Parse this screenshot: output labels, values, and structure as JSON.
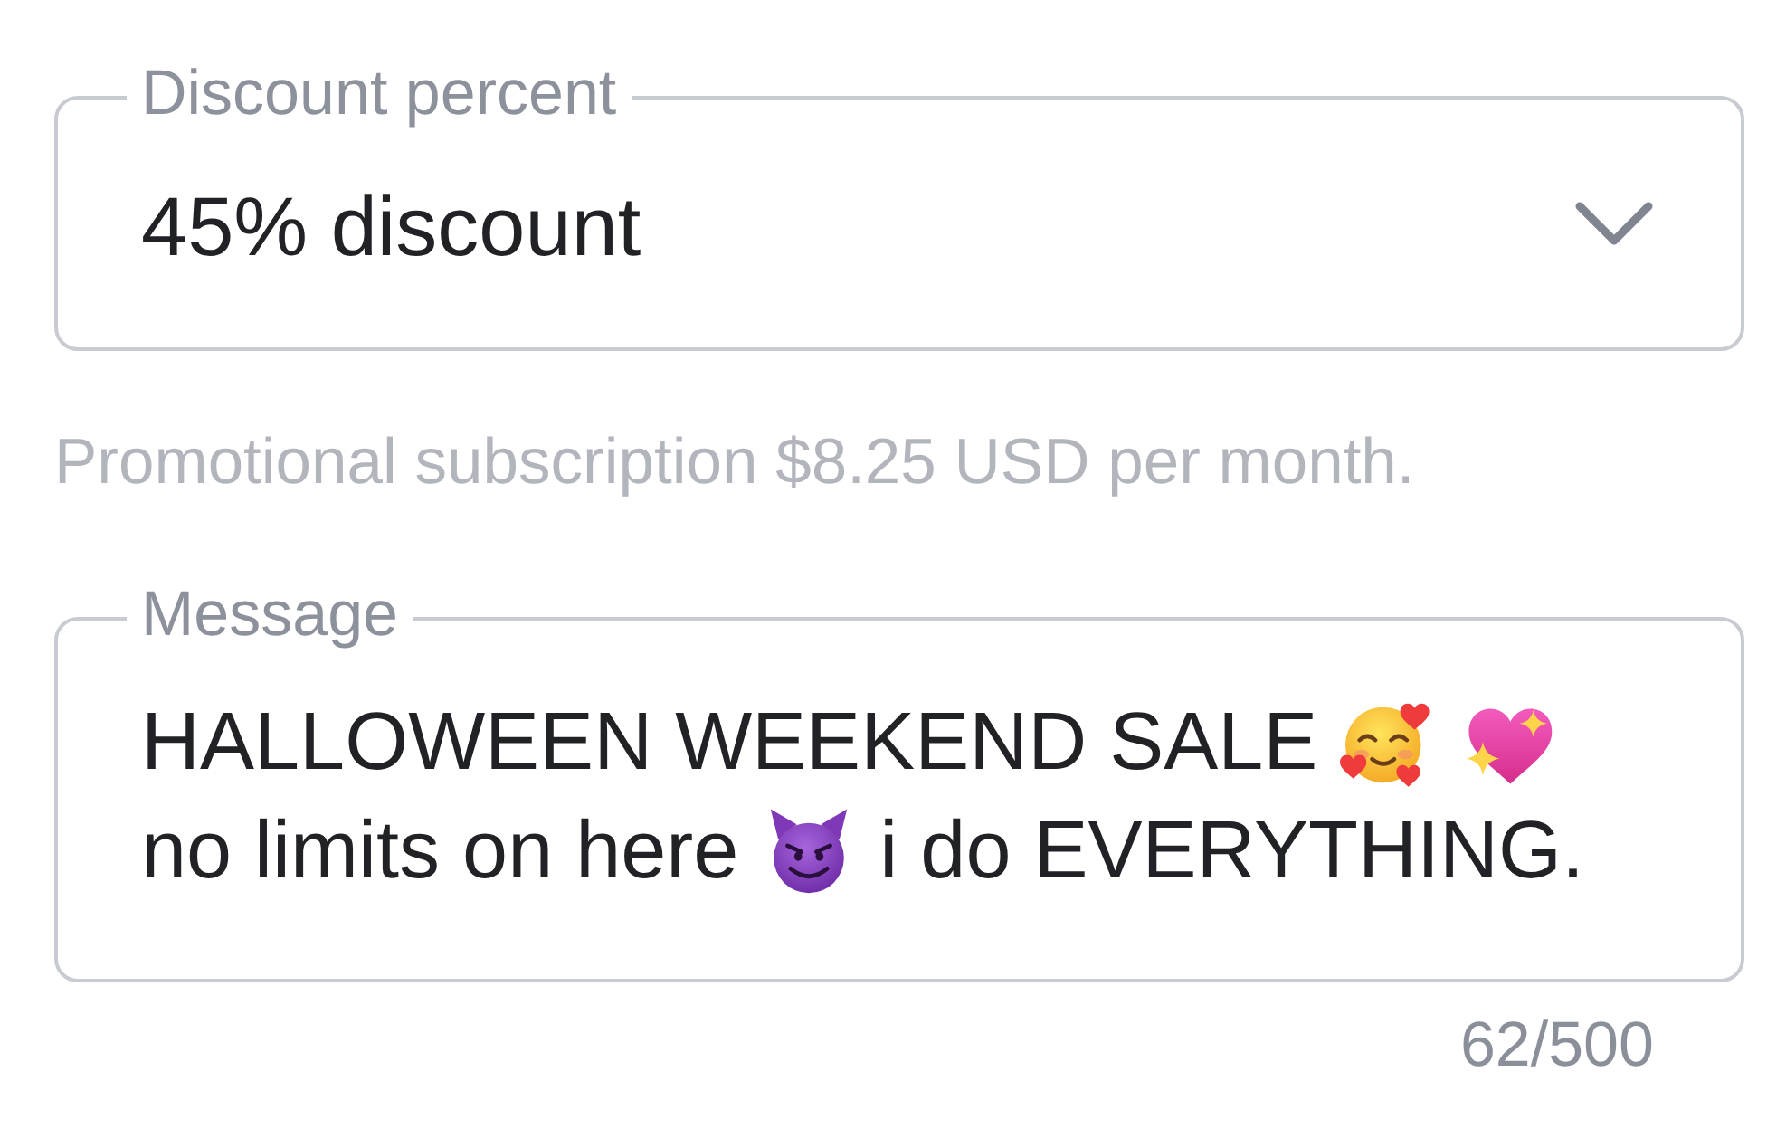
{
  "discount_field": {
    "label": "Discount percent",
    "value": "45% discount"
  },
  "helper_text": "Promotional subscription $8.25 USD per month.",
  "message_field": {
    "label": "Message",
    "lines": [
      [
        {
          "kind": "text",
          "text": "HALLOWEEN WEEKEND SALE"
        },
        {
          "kind": "emoji"
        },
        {
          "kind": "emoji"
        }
      ],
      [
        {
          "kind": "text",
          "text": "no limits on here"
        },
        {
          "kind": "emoji"
        },
        {
          "kind": "text",
          "text": "i do EVERYTHING."
        }
      ]
    ]
  },
  "counter": "62/500"
}
